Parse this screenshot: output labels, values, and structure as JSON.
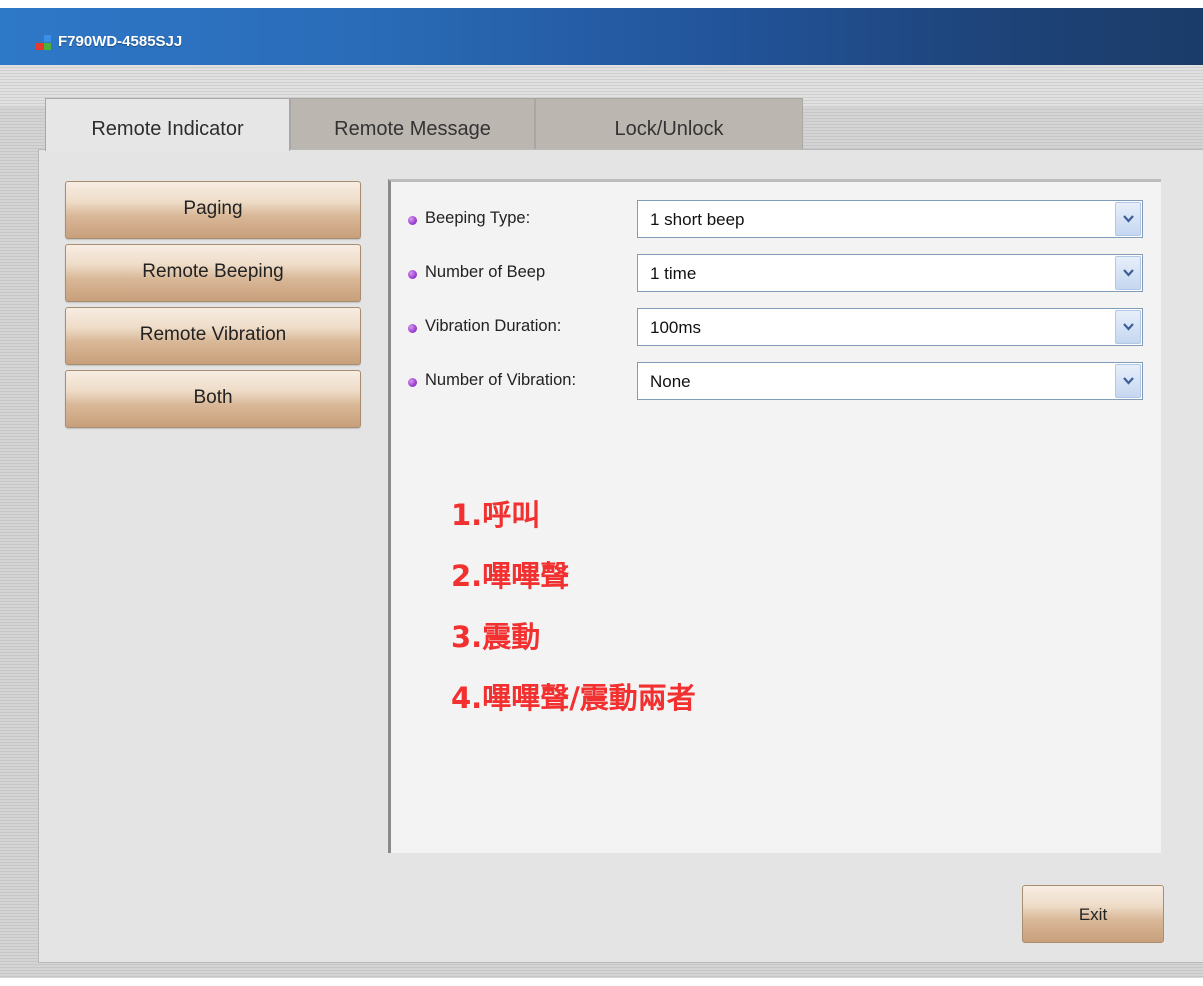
{
  "window": {
    "title": "F790WD-4585SJJ"
  },
  "tabs": [
    {
      "label": "Remote Indicator",
      "active": true
    },
    {
      "label": "Remote Message",
      "active": false
    },
    {
      "label": "Lock/Unlock",
      "active": false
    }
  ],
  "left_buttons": [
    {
      "label": "Paging"
    },
    {
      "label": "Remote Beeping"
    },
    {
      "label": "Remote Vibration"
    },
    {
      "label": "Both"
    }
  ],
  "fields": [
    {
      "label": "Beeping Type:",
      "value": "1 short beep"
    },
    {
      "label": "Number of Beep",
      "value": "1 time"
    },
    {
      "label": "Vibration Duration:",
      "value": "100ms"
    },
    {
      "label": "Number of Vibration:",
      "value": "None"
    }
  ],
  "annotations": [
    "1.呼叫",
    "2.嗶嗶聲",
    "3.震動",
    "4.嗶嗶聲/震動兩者"
  ],
  "exit_label": "Exit",
  "colors": {
    "titlebar": "#2a6cb8",
    "annotation": "#f23030",
    "bullet": "#9a3fd0",
    "button": "#d9b898"
  }
}
